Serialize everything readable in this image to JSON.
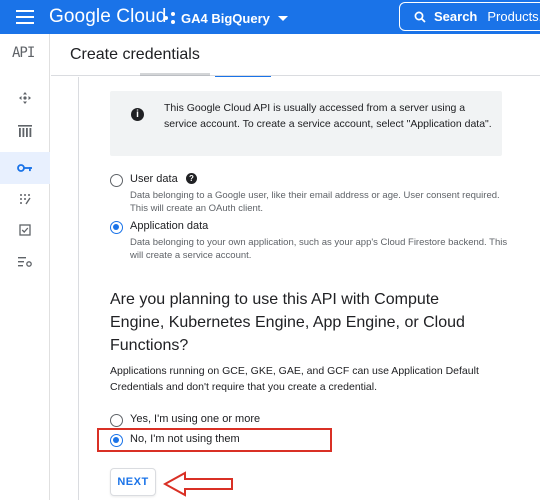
{
  "topbar": {
    "brand": "Google Cloud",
    "project": "GA4 BigQuery",
    "search_label": "Search",
    "search_placeholder": "Products,"
  },
  "sidebar": {
    "logo": "API",
    "items": [
      {
        "icon": "move-icon"
      },
      {
        "icon": "library-icon"
      },
      {
        "icon": "key-icon",
        "active": true
      },
      {
        "icon": "consent-icon"
      },
      {
        "icon": "checkbox-icon"
      },
      {
        "icon": "settings-list-icon"
      }
    ]
  },
  "header": {
    "title": "Create credentials"
  },
  "info": {
    "text": "This Google Cloud API is usually accessed from a server using a service account. To create a service account, select \"Application data\"."
  },
  "data_type": {
    "options": [
      {
        "label": "User data",
        "desc": "Data belonging to a Google user, like their email address or age. User consent required. This will create an OAuth client.",
        "checked": false
      },
      {
        "label": "Application data",
        "desc": "Data belonging to your own application, such as your app's Cloud Firestore backend. This will create a service account.",
        "checked": true
      }
    ]
  },
  "compute": {
    "question": "Are you planning to use this API with Compute Engine, Kubernetes Engine, App Engine, or Cloud Functions?",
    "desc": "Applications running on GCE, GKE, GAE, and GCF can use Application Default Credentials and don't require that you create a credential.",
    "options": [
      {
        "label": "Yes, I'm using one or more",
        "checked": false
      },
      {
        "label": "No, I'm not using them",
        "checked": true
      }
    ]
  },
  "actions": {
    "next_label": "NEXT"
  },
  "colors": {
    "primary": "#1a73e8",
    "highlight": "#d93025"
  }
}
